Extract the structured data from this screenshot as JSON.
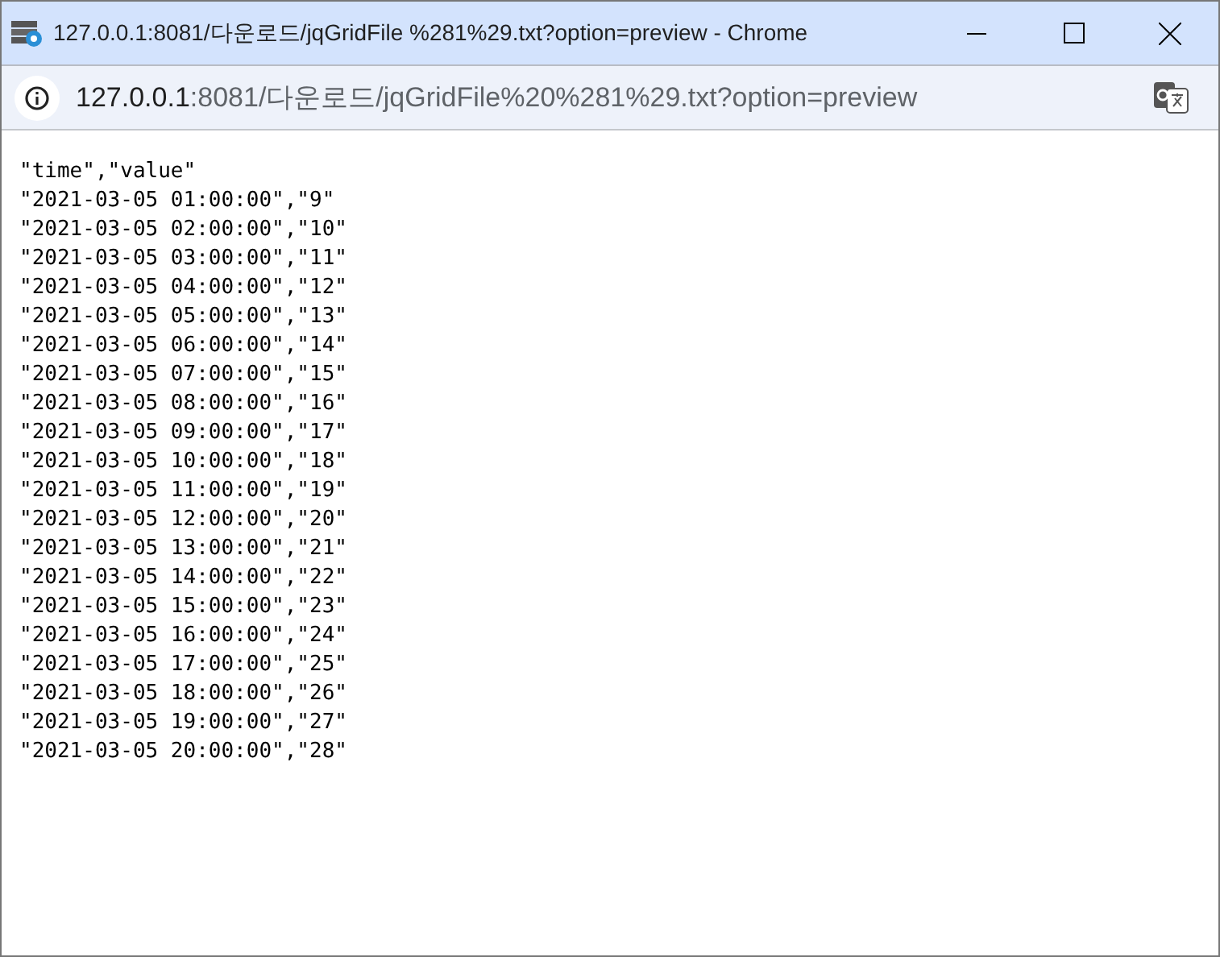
{
  "window": {
    "title": "127.0.0.1:8081/다운로드/jqGridFile %281%29.txt?option=preview - Chrome"
  },
  "address_bar": {
    "host": "127.0.0.1",
    "path": ":8081/다운로드/jqGridFile%20%281%29.txt?option=preview"
  },
  "document": {
    "lines": [
      "\"time\",\"value\"",
      "\"2021-03-05 01:00:00\",\"9\"",
      "\"2021-03-05 02:00:00\",\"10\"",
      "\"2021-03-05 03:00:00\",\"11\"",
      "\"2021-03-05 04:00:00\",\"12\"",
      "\"2021-03-05 05:00:00\",\"13\"",
      "\"2021-03-05 06:00:00\",\"14\"",
      "\"2021-03-05 07:00:00\",\"15\"",
      "\"2021-03-05 08:00:00\",\"16\"",
      "\"2021-03-05 09:00:00\",\"17\"",
      "\"2021-03-05 10:00:00\",\"18\"",
      "\"2021-03-05 11:00:00\",\"19\"",
      "\"2021-03-05 12:00:00\",\"20\"",
      "\"2021-03-05 13:00:00\",\"21\"",
      "\"2021-03-05 14:00:00\",\"22\"",
      "\"2021-03-05 15:00:00\",\"23\"",
      "\"2021-03-05 16:00:00\",\"24\"",
      "\"2021-03-05 17:00:00\",\"25\"",
      "\"2021-03-05 18:00:00\",\"26\"",
      "\"2021-03-05 19:00:00\",\"27\"",
      "\"2021-03-05 20:00:00\",\"28\""
    ]
  }
}
